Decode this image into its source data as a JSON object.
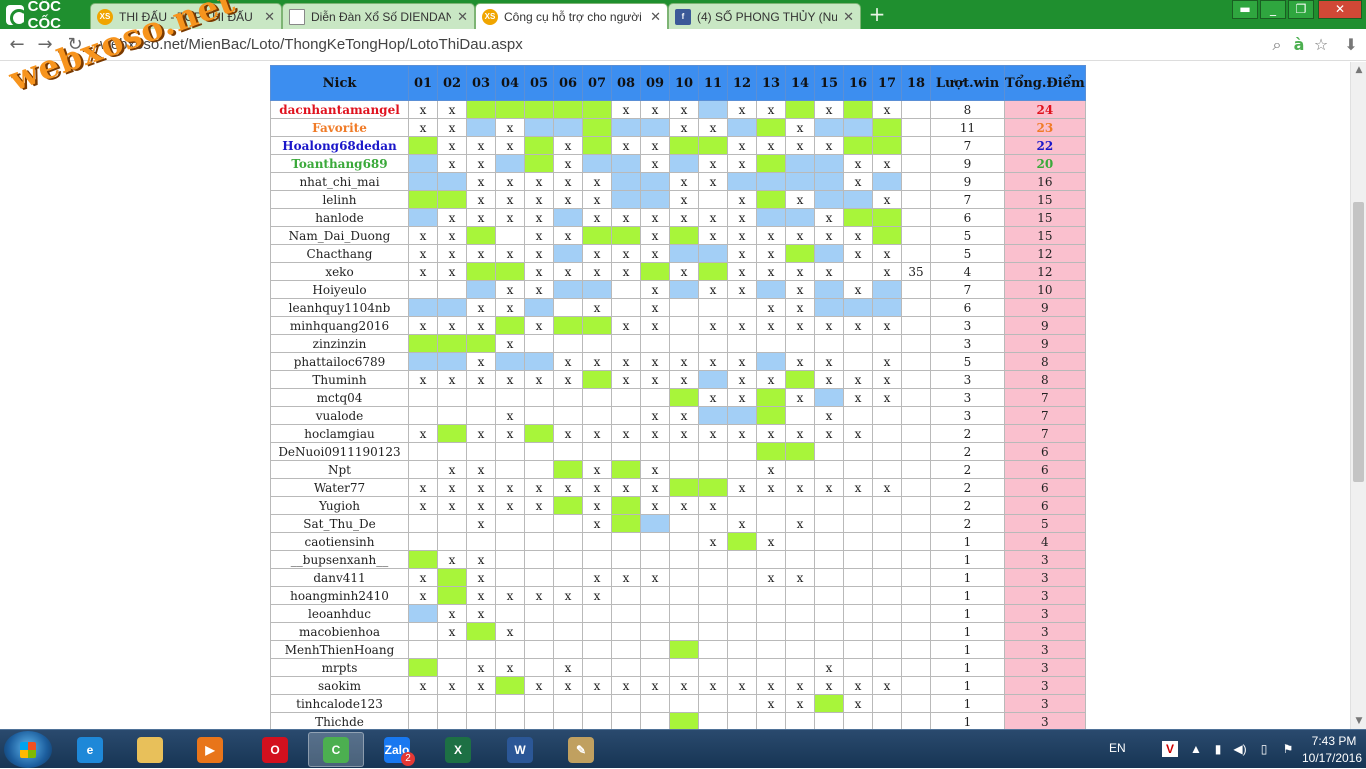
{
  "browser": {
    "brand": "CỐC CỐC",
    "tabs": [
      {
        "title": "THI ĐẤU - TOP THI ĐẤU",
        "icon": "xs-favicon",
        "active": false
      },
      {
        "title": "Diễn Đàn Xổ Số DIENDAN",
        "icon": "document-favicon",
        "active": false
      },
      {
        "title": "Công cụ hỗ trợ cho người",
        "icon": "xs-favicon",
        "active": true
      },
      {
        "title": "(4) SỐ PHONG THỦY (Num",
        "icon": "facebook-favicon",
        "active": false
      }
    ],
    "url": "webxoso.net/MienBac/Loto/ThongKeTongHop/LotoThiDau.aspx",
    "watermark": "webxoso.net"
  },
  "table": {
    "headers": {
      "nick": "Nick",
      "numbers": [
        "01",
        "02",
        "03",
        "04",
        "05",
        "06",
        "07",
        "08",
        "09",
        "10",
        "11",
        "12",
        "13",
        "14",
        "15",
        "16",
        "17",
        "18"
      ],
      "luot": "Lượt.win",
      "tong": "Tổng.Điểm"
    },
    "rows": [
      {
        "nick": "dacnhantamangel",
        "rank": "top1",
        "cells": [
          "x",
          "x",
          "g",
          "g",
          "g",
          "g",
          "g",
          "x",
          "x",
          "x",
          "b",
          "x",
          "x",
          "g",
          "x",
          "g",
          "x",
          ""
        ],
        "luot": "8",
        "tong": "24"
      },
      {
        "nick": "Favorite",
        "rank": "top2",
        "cells": [
          "x",
          "x",
          "b",
          "x",
          "b",
          "b",
          "g",
          "b",
          "b",
          "x",
          "x",
          "b",
          "g",
          "x",
          "b",
          "b",
          "g",
          ""
        ],
        "luot": "11",
        "tong": "23"
      },
      {
        "nick": "Hoalong68dedan",
        "rank": "top3",
        "cells": [
          "g",
          "x",
          "x",
          "x",
          "g",
          "x",
          "g",
          "x",
          "x",
          "g",
          "g",
          "x",
          "x",
          "x",
          "x",
          "g",
          "g",
          ""
        ],
        "luot": "7",
        "tong": "22"
      },
      {
        "nick": "Toanthang689",
        "rank": "top4",
        "cells": [
          "b",
          "x",
          "x",
          "b",
          "g",
          "x",
          "b",
          "b",
          "x",
          "b",
          "x",
          "x",
          "g",
          "b",
          "b",
          "x",
          "x",
          ""
        ],
        "luot": "9",
        "tong": "20"
      },
      {
        "nick": "nhat_chi_mai",
        "rank": "",
        "cells": [
          "b",
          "b",
          "x",
          "x",
          "x",
          "x",
          "x",
          "b",
          "b",
          "x",
          "x",
          "b",
          "b",
          "b",
          "b",
          "x",
          "b",
          ""
        ],
        "luot": "9",
        "tong": "16"
      },
      {
        "nick": "lelinh",
        "rank": "",
        "cells": [
          "g",
          "g",
          "x",
          "x",
          "x",
          "x",
          "x",
          "b",
          "b",
          "x",
          "",
          "x",
          "g",
          "x",
          "b",
          "b",
          "x",
          ""
        ],
        "luot": "7",
        "tong": "15"
      },
      {
        "nick": "hanlode",
        "rank": "",
        "cells": [
          "b",
          "x",
          "x",
          "x",
          "x",
          "b",
          "x",
          "x",
          "x",
          "x",
          "x",
          "x",
          "b",
          "b",
          "x",
          "g",
          "g",
          ""
        ],
        "luot": "6",
        "tong": "15"
      },
      {
        "nick": "Nam_Dai_Duong",
        "rank": "",
        "cells": [
          "x",
          "x",
          "g",
          "",
          "x",
          "x",
          "g",
          "g",
          "x",
          "g",
          "x",
          "x",
          "x",
          "x",
          "x",
          "x",
          "g",
          ""
        ],
        "luot": "5",
        "tong": "15"
      },
      {
        "nick": "Chacthang",
        "rank": "",
        "cells": [
          "x",
          "x",
          "x",
          "x",
          "x",
          "b",
          "x",
          "x",
          "x",
          "b",
          "b",
          "x",
          "x",
          "g",
          "b",
          "x",
          "x",
          ""
        ],
        "luot": "5",
        "tong": "12"
      },
      {
        "nick": "xeko",
        "rank": "",
        "cells": [
          "x",
          "x",
          "g",
          "g",
          "x",
          "x",
          "x",
          "x",
          "g",
          "x",
          "g",
          "x",
          "x",
          "x",
          "x",
          "",
          "x",
          "35"
        ],
        "luot": "4",
        "tong": "12"
      },
      {
        "nick": "Hoiyeulo",
        "rank": "",
        "cells": [
          "",
          "",
          "b",
          "x",
          "x",
          "b",
          "b",
          "",
          "x",
          "b",
          "x",
          "x",
          "b",
          "x",
          "b",
          "x",
          "b",
          ""
        ],
        "luot": "7",
        "tong": "10"
      },
      {
        "nick": "leanhquy1104nb",
        "rank": "",
        "cells": [
          "b",
          "b",
          "x",
          "x",
          "b",
          "",
          "x",
          "",
          "x",
          "",
          "",
          "",
          "x",
          "x",
          "b",
          "b",
          "b",
          ""
        ],
        "luot": "6",
        "tong": "9"
      },
      {
        "nick": "minhquang2016",
        "rank": "",
        "cells": [
          "x",
          "x",
          "x",
          "g",
          "x",
          "g",
          "g",
          "x",
          "x",
          "",
          "x",
          "x",
          "x",
          "x",
          "x",
          "x",
          "x",
          ""
        ],
        "luot": "3",
        "tong": "9"
      },
      {
        "nick": "zinzinzin",
        "rank": "",
        "cells": [
          "g",
          "g",
          "g",
          "x",
          "",
          "",
          "",
          "",
          "",
          "",
          "",
          "",
          "",
          "",
          "",
          "",
          "",
          ""
        ],
        "luot": "3",
        "tong": "9"
      },
      {
        "nick": "phattailoc6789",
        "rank": "",
        "cells": [
          "b",
          "b",
          "x",
          "b",
          "b",
          "x",
          "x",
          "x",
          "x",
          "x",
          "x",
          "x",
          "b",
          "x",
          "x",
          "",
          "x",
          ""
        ],
        "luot": "5",
        "tong": "8"
      },
      {
        "nick": "Thuminh",
        "rank": "",
        "cells": [
          "x",
          "x",
          "x",
          "x",
          "x",
          "x",
          "g",
          "x",
          "x",
          "x",
          "b",
          "x",
          "x",
          "g",
          "x",
          "x",
          "x",
          ""
        ],
        "luot": "3",
        "tong": "8"
      },
      {
        "nick": "mctq04",
        "rank": "",
        "cells": [
          "",
          "",
          "",
          "",
          "",
          "",
          "",
          "",
          "",
          "g",
          "x",
          "x",
          "g",
          "x",
          "b",
          "x",
          "x",
          ""
        ],
        "luot": "3",
        "tong": "7"
      },
      {
        "nick": "vualode",
        "rank": "",
        "cells": [
          "",
          "",
          "",
          "x",
          "",
          "",
          "",
          "",
          "x",
          "x",
          "b",
          "b",
          "g",
          "",
          "x",
          "",
          "",
          ""
        ],
        "luot": "3",
        "tong": "7"
      },
      {
        "nick": "hoclamgiau",
        "rank": "",
        "cells": [
          "x",
          "g",
          "x",
          "x",
          "g",
          "x",
          "x",
          "x",
          "x",
          "x",
          "x",
          "x",
          "x",
          "x",
          "x",
          "x",
          "",
          ""
        ],
        "luot": "2",
        "tong": "7"
      },
      {
        "nick": "DeNuoi0911190123",
        "rank": "",
        "cells": [
          "",
          "",
          "",
          "",
          "",
          "",
          "",
          "",
          "",
          "",
          "",
          "",
          "g",
          "g",
          "",
          "",
          "",
          ""
        ],
        "luot": "2",
        "tong": "6"
      },
      {
        "nick": "Npt",
        "rank": "",
        "cells": [
          "",
          "x",
          "x",
          "",
          "",
          "g",
          "x",
          "g",
          "x",
          "",
          "",
          "",
          "x",
          "",
          "",
          "",
          "",
          ""
        ],
        "luot": "2",
        "tong": "6"
      },
      {
        "nick": "Water77",
        "rank": "",
        "cells": [
          "x",
          "x",
          "x",
          "x",
          "x",
          "x",
          "x",
          "x",
          "x",
          "g",
          "g",
          "x",
          "x",
          "x",
          "x",
          "x",
          "x",
          ""
        ],
        "luot": "2",
        "tong": "6"
      },
      {
        "nick": "Yugioh",
        "rank": "",
        "cells": [
          "x",
          "x",
          "x",
          "x",
          "x",
          "g",
          "x",
          "g",
          "x",
          "x",
          "x",
          "",
          "",
          "",
          "",
          "",
          "",
          ""
        ],
        "luot": "2",
        "tong": "6"
      },
      {
        "nick": "Sat_Thu_De",
        "rank": "",
        "cells": [
          "",
          "",
          "x",
          "",
          "",
          "",
          "x",
          "g",
          "b",
          "",
          "",
          "x",
          "",
          "x",
          "",
          "",
          "",
          ""
        ],
        "luot": "2",
        "tong": "5"
      },
      {
        "nick": "caotiensinh",
        "rank": "",
        "cells": [
          "",
          "",
          "",
          "",
          "",
          "",
          "",
          "",
          "",
          "",
          "x",
          "g",
          "x",
          "",
          "",
          "",
          "",
          ""
        ],
        "luot": "1",
        "tong": "4"
      },
      {
        "nick": "__bupsenxanh__",
        "rank": "",
        "cells": [
          "g",
          "x",
          "x",
          "",
          "",
          "",
          "",
          "",
          "",
          "",
          "",
          "",
          "",
          "",
          "",
          "",
          "",
          ""
        ],
        "luot": "1",
        "tong": "3"
      },
      {
        "nick": "danv411",
        "rank": "",
        "cells": [
          "x",
          "g",
          "x",
          "",
          "",
          "",
          "x",
          "x",
          "x",
          "",
          "",
          "",
          "x",
          "x",
          "",
          "",
          "",
          ""
        ],
        "luot": "1",
        "tong": "3"
      },
      {
        "nick": "hoangminh2410",
        "rank": "",
        "cells": [
          "x",
          "g",
          "x",
          "x",
          "x",
          "x",
          "x",
          "",
          "",
          "",
          "",
          "",
          "",
          "",
          "",
          "",
          "",
          ""
        ],
        "luot": "1",
        "tong": "3"
      },
      {
        "nick": "leoanhduc",
        "rank": "",
        "cells": [
          "b",
          "x",
          "x",
          "",
          "",
          "",
          "",
          "",
          "",
          "",
          "",
          "",
          "",
          "",
          "",
          "",
          "",
          ""
        ],
        "luot": "1",
        "tong": "3"
      },
      {
        "nick": "macobienhoa",
        "rank": "",
        "cells": [
          "",
          "x",
          "g",
          "x",
          "",
          "",
          "",
          "",
          "",
          "",
          "",
          "",
          "",
          "",
          "",
          "",
          "",
          ""
        ],
        "luot": "1",
        "tong": "3"
      },
      {
        "nick": "MenhThienHoang",
        "rank": "",
        "cells": [
          "",
          "",
          "",
          "",
          "",
          "",
          "",
          "",
          "",
          "g",
          "",
          "",
          "",
          "",
          "",
          "",
          "",
          ""
        ],
        "luot": "1",
        "tong": "3"
      },
      {
        "nick": "mrpts",
        "rank": "",
        "cells": [
          "g",
          "",
          "x",
          "x",
          "",
          "x",
          "",
          "",
          "",
          "",
          "",
          "",
          "",
          "",
          "x",
          "",
          "",
          ""
        ],
        "luot": "1",
        "tong": "3"
      },
      {
        "nick": "saokim",
        "rank": "",
        "cells": [
          "x",
          "x",
          "x",
          "g",
          "x",
          "x",
          "x",
          "x",
          "x",
          "x",
          "x",
          "x",
          "x",
          "x",
          "x",
          "x",
          "x",
          ""
        ],
        "luot": "1",
        "tong": "3"
      },
      {
        "nick": "tinhcalode123",
        "rank": "",
        "cells": [
          "",
          "",
          "",
          "",
          "",
          "",
          "",
          "",
          "",
          "",
          "",
          "",
          "x",
          "x",
          "g",
          "x",
          "",
          ""
        ],
        "luot": "1",
        "tong": "3"
      },
      {
        "nick": "Thichde",
        "rank": "",
        "cells": [
          "",
          "",
          "",
          "",
          "",
          "",
          "",
          "",
          "",
          "g",
          "",
          "",
          "",
          "",
          "",
          "",
          "",
          ""
        ],
        "luot": "1",
        "tong": "3"
      }
    ]
  },
  "taskbar": {
    "apps": [
      {
        "name": "internet-explorer",
        "label": "e",
        "color": "#1e88d8"
      },
      {
        "name": "file-explorer",
        "label": "",
        "color": "#e8c05a"
      },
      {
        "name": "media-player",
        "label": "▶",
        "color": "#e8751a"
      },
      {
        "name": "opera",
        "label": "O",
        "color": "#d3101e"
      },
      {
        "name": "coccoc",
        "label": "C",
        "color": "#4caf50"
      },
      {
        "name": "zalo",
        "label": "Zalo",
        "color": "#1878f0"
      },
      {
        "name": "excel",
        "label": "X",
        "color": "#1d7044"
      },
      {
        "name": "word",
        "label": "W",
        "color": "#2b5797"
      },
      {
        "name": "paint",
        "label": "✎",
        "color": "#c0a060"
      }
    ],
    "zalo_badge": "2",
    "language": "EN",
    "time": "7:43 PM",
    "date": "10/17/2016"
  }
}
